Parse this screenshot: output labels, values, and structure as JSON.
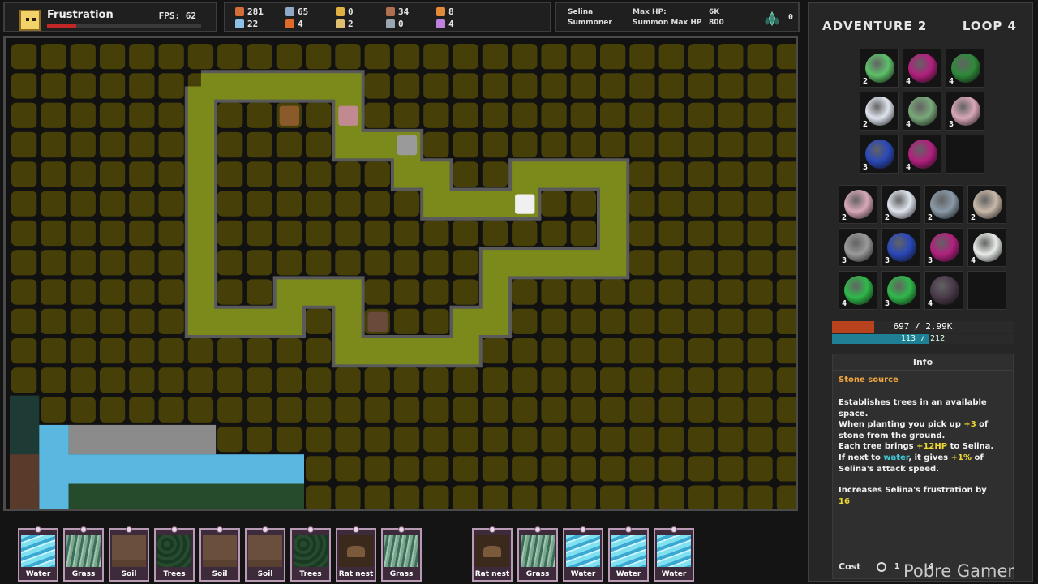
{
  "hero": {
    "mood_label": "Frustration",
    "fps_text": "FPS: 62",
    "frustration_fraction": 0.19
  },
  "resources": [
    {
      "icon": "wood-icon",
      "color": "#d36e3a",
      "value": "281"
    },
    {
      "icon": "stone-icon",
      "color": "#8ea8c8",
      "value": "65"
    },
    {
      "icon": "metal-icon",
      "color": "#e0b040",
      "value": "0"
    },
    {
      "icon": "food-icon",
      "color": "#b07050",
      "value": "34"
    },
    {
      "icon": "leather-icon",
      "color": "#e08a3a",
      "value": "8"
    },
    {
      "icon": "herb-icon",
      "color": "#8ec1e6",
      "value": "22"
    },
    {
      "icon": "flame-icon",
      "color": "#e06a2a",
      "value": "4"
    },
    {
      "icon": "shard-icon",
      "color": "#e0c070",
      "value": "2"
    },
    {
      "icon": "gear-icon",
      "color": "#9aa7b0",
      "value": "0"
    },
    {
      "icon": "crystal-icon",
      "color": "#c080e0",
      "value": "4"
    }
  ],
  "character": {
    "name": "Selina",
    "class": "Summoner",
    "max_hp_label": "Max HP:",
    "max_hp_value": "6K",
    "summon_hp_label": "Summon Max HP",
    "summon_hp_value": "800",
    "loop_icon_count": "0"
  },
  "side": {
    "adventure": "ADVENTURE 2",
    "loop": "LOOP 4",
    "equipped": [
      {
        "color": "#5ec06a",
        "level": "2"
      },
      {
        "color": "#b2207e",
        "level": "4"
      },
      {
        "color": "#2f8a3a",
        "level": "4"
      },
      {
        "color": "#dfe4ee",
        "level": "2"
      },
      {
        "color": "#7aa87a",
        "level": "4"
      },
      {
        "color": "#d8a8b8",
        "level": "3"
      },
      {
        "color": "#2a48b8",
        "level": "3"
      },
      {
        "color": "#b2207e",
        "level": "4"
      },
      {
        "color": "#2a2a2a",
        "level": ""
      }
    ],
    "inventory": [
      {
        "color": "#d8a8b8",
        "level": "2"
      },
      {
        "color": "#dfe4ee",
        "level": "2"
      },
      {
        "color": "#8a9aa8",
        "level": "2"
      },
      {
        "color": "#c8b8a8",
        "level": "2"
      },
      {
        "color": "#9a9a9a",
        "level": "3"
      },
      {
        "color": "#2a48b8",
        "level": "3"
      },
      {
        "color": "#b2207e",
        "level": "3"
      },
      {
        "color": "#e8ece8",
        "level": "4"
      },
      {
        "color": "#2fb84a",
        "level": "4"
      },
      {
        "color": "#2fb84a",
        "level": "3"
      },
      {
        "color": "#4a3a4a",
        "level": "4"
      },
      {
        "color": "#2a2a2a",
        "level": ""
      }
    ],
    "hp_text": "697 / 2.99K",
    "hp_fraction": 0.23,
    "mp_text": "113 / 212",
    "mp_fraction": 0.53
  },
  "info": {
    "title": "Info",
    "card_name": "Stone source",
    "line1": "Establishes trees in an available space.",
    "line2a": "When planting you pick up ",
    "line2b": "+3",
    "line2c": " of stone from the ground.",
    "line3a": "Each tree brings ",
    "line3b": "+12HP",
    "line3c": " to Selina.",
    "line4a": "If next to ",
    "line4b": "water",
    "line4c": ", it gives ",
    "line4d": "+1%",
    "line4e": " of Selina's attack speed.",
    "line5": "Increases Selina's frustration by ",
    "line5_value": "16",
    "cost_label": "Cost",
    "cost_value": "1",
    "cost_value2": "4"
  },
  "hand": [
    {
      "name": "Water",
      "art": "water"
    },
    {
      "name": "Grass",
      "art": "grass"
    },
    {
      "name": "Soil",
      "art": "soil"
    },
    {
      "name": "Trees",
      "art": "trees"
    },
    {
      "name": "Soil",
      "art": "soil"
    },
    {
      "name": "Soil",
      "art": "soil"
    },
    {
      "name": "Trees",
      "art": "trees"
    },
    {
      "name": "Rat nest",
      "art": "ratnest"
    },
    {
      "name": "Grass",
      "art": "grass"
    },
    {
      "name": "Rat nest",
      "art": "ratnest"
    },
    {
      "name": "Grass",
      "art": "grass"
    },
    {
      "name": "Water",
      "art": "water"
    },
    {
      "name": "Water",
      "art": "water"
    },
    {
      "name": "Water",
      "art": "water"
    }
  ],
  "watermark": "Pobre Gamer"
}
